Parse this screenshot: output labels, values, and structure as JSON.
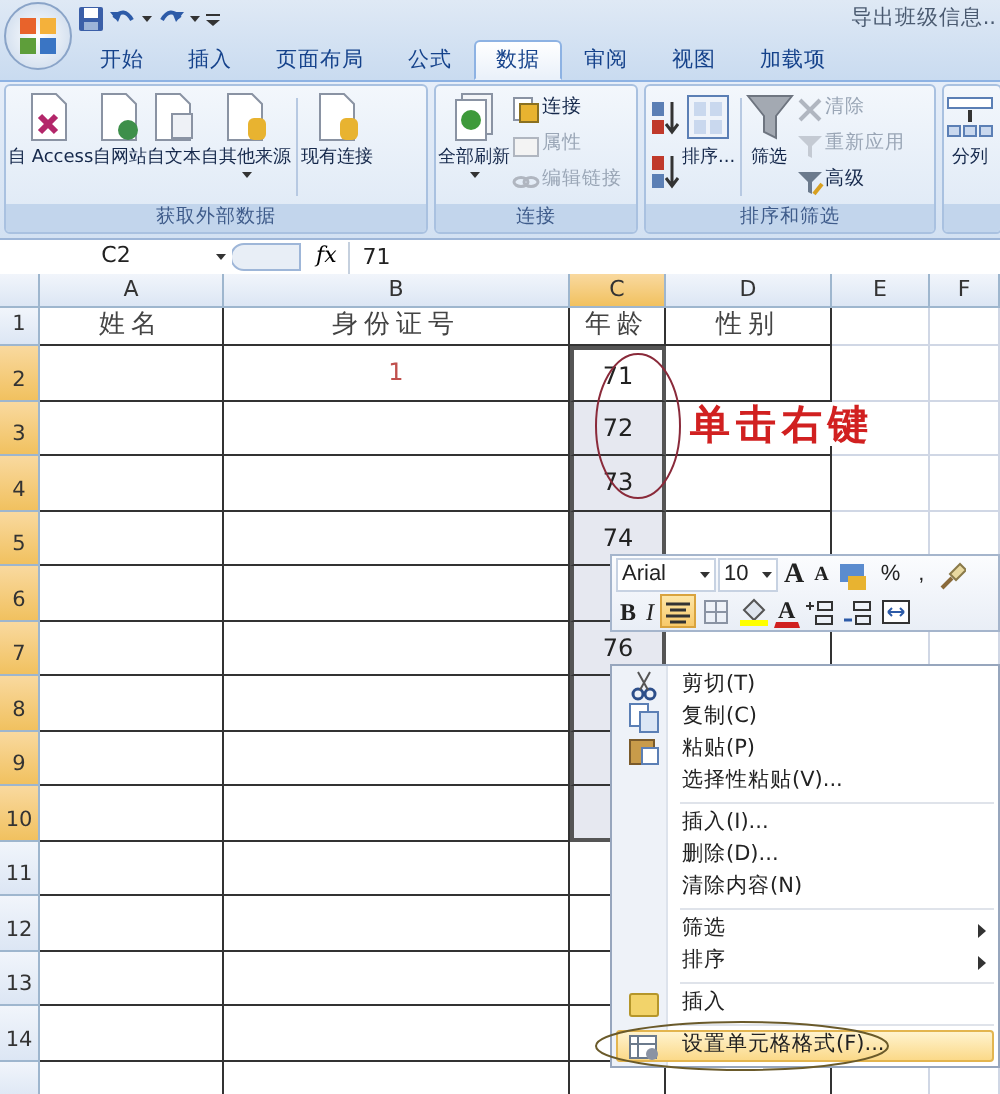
{
  "title_bar": {
    "title": "导出班级信息.."
  },
  "tabs": [
    {
      "label": "开始",
      "selected": false
    },
    {
      "label": "插入",
      "selected": false
    },
    {
      "label": "页面布局",
      "selected": false
    },
    {
      "label": "公式",
      "selected": false
    },
    {
      "label": "数据",
      "selected": true
    },
    {
      "label": "审阅",
      "selected": false
    },
    {
      "label": "视图",
      "selected": false
    },
    {
      "label": "加载项",
      "selected": false
    }
  ],
  "ribbon_groups": [
    {
      "label": "获取外部数据",
      "buttons": [
        {
          "label": "自 Access",
          "kind": "large",
          "dropdown": false
        },
        {
          "label": "自网站",
          "kind": "large",
          "dropdown": false
        },
        {
          "label": "自文本",
          "kind": "large",
          "dropdown": false
        },
        {
          "label": "自其他来源",
          "kind": "large",
          "dropdown": true
        },
        {
          "label": "现有连接",
          "kind": "large",
          "dropdown": false,
          "divider_before": true
        }
      ]
    },
    {
      "label": "连接",
      "buttons": [
        {
          "label": "全部刷新",
          "kind": "large",
          "dropdown": true
        },
        {
          "label": "连接",
          "kind": "small",
          "disabled": false
        },
        {
          "label": "属性",
          "kind": "small",
          "disabled": true
        },
        {
          "label": "编辑链接",
          "kind": "small",
          "disabled": true
        }
      ]
    },
    {
      "label": "排序和筛选",
      "buttons": [
        {
          "kind": "icon"
        },
        {
          "kind": "icon"
        },
        {
          "label": "排序...",
          "kind": "large",
          "dropdown": false
        },
        {
          "label": "筛选",
          "kind": "large",
          "dropdown": false,
          "divider_before": true
        },
        {
          "label": "清除",
          "kind": "small",
          "disabled": true
        },
        {
          "label": "重新应用",
          "kind": "small",
          "disabled": true
        },
        {
          "label": "高级",
          "kind": "small",
          "disabled": false
        }
      ]
    },
    {
      "buttons": [
        {
          "label": "分列",
          "kind": "large",
          "dropdown": false
        }
      ]
    }
  ],
  "formula_bar": {
    "name_box": "C2",
    "insert_function": "fx",
    "value": "71"
  },
  "columns": [
    {
      "label": "A",
      "selected": false
    },
    {
      "label": "B",
      "selected": false
    },
    {
      "label": "C",
      "selected": true
    },
    {
      "label": "D",
      "selected": false
    },
    {
      "label": "E",
      "selected": false
    },
    {
      "label": "F",
      "selected": false
    }
  ],
  "rows": [
    {
      "label": "1",
      "selected": false,
      "cells": {
        "a": {
          "text": "姓名"
        },
        "b": {
          "text": "身份证号"
        },
        "c": {
          "text": "年龄"
        },
        "d": {
          "text": "性别"
        }
      }
    },
    {
      "label": "2",
      "selected": true,
      "cells": {
        "b": {
          "text": "1",
          "color": "#c0504d"
        },
        "c": {
          "text": "71",
          "active": true
        }
      }
    },
    {
      "label": "3",
      "selected": true,
      "cells": {
        "c": {
          "text": "72",
          "active": false
        }
      }
    },
    {
      "label": "4",
      "selected": true,
      "cells": {
        "c": {
          "text": "73",
          "active": false
        }
      }
    },
    {
      "label": "5",
      "selected": true,
      "cells": {
        "c": {
          "text": "74",
          "active": false
        }
      }
    },
    {
      "label": "6",
      "selected": true,
      "cells": {}
    },
    {
      "label": "7",
      "selected": true,
      "cells": {
        "c": {
          "text": "76",
          "active": false
        }
      }
    },
    {
      "label": "8",
      "selected": true,
      "cells": {}
    },
    {
      "label": "9",
      "selected": true,
      "cells": {}
    },
    {
      "label": "10",
      "selected": true,
      "cells": {}
    },
    {
      "label": "11",
      "selected": false,
      "cells": {}
    },
    {
      "label": "12",
      "selected": false,
      "cells": {}
    },
    {
      "label": "13",
      "selected": false,
      "cells": {}
    },
    {
      "label": "14",
      "selected": false,
      "cells": {}
    }
  ],
  "annotation": {
    "text": "单击右键"
  },
  "mini_toolbar": {
    "font": "Arial",
    "size": "10",
    "row_1": [
      {
        "kind": "grow",
        "label": "A"
      },
      {
        "kind": "shrink",
        "label": "A"
      },
      {
        "kind": "styles"
      },
      {
        "kind": "text",
        "label": "%"
      },
      {
        "kind": "text",
        "label": ","
      },
      {
        "kind": "painter"
      }
    ],
    "row_2": [
      {
        "kind": "bold",
        "label": "B",
        "on": false
      },
      {
        "kind": "italic",
        "label": "I",
        "on": false
      },
      {
        "kind": "align",
        "on": true
      },
      {
        "kind": "borders",
        "on": false
      },
      {
        "kind": "fill",
        "on": false
      },
      {
        "kind": "fontcolor",
        "label": "A",
        "on": false
      },
      {
        "kind": "inc_decimal",
        "on": false
      },
      {
        "kind": "dec_decimal",
        "on": false
      },
      {
        "kind": "merge",
        "on": false
      }
    ]
  },
  "context_menu": [
    {
      "kind": "cut",
      "label": "剪切(T)",
      "submenu": false,
      "selected": false
    },
    {
      "kind": "copy",
      "label": "复制(C)",
      "submenu": false,
      "selected": false
    },
    {
      "kind": "paste",
      "label": "粘贴(P)",
      "submenu": false,
      "selected": false
    },
    {
      "kind": "plain",
      "label": "选择性粘贴(V)...",
      "submenu": false,
      "selected": false
    },
    {
      "kind": "separator"
    },
    {
      "kind": "plain",
      "label": "插入(I)...",
      "submenu": false,
      "selected": false
    },
    {
      "kind": "plain",
      "label": "删除(D)...",
      "submenu": false,
      "selected": false
    },
    {
      "kind": "plain",
      "label": "清除内容(N)",
      "submenu": false,
      "selected": false
    },
    {
      "kind": "separator"
    },
    {
      "kind": "plain",
      "label": "筛选",
      "submenu": true,
      "selected": false
    },
    {
      "kind": "plain",
      "label": "排序",
      "submenu": true,
      "selected": false
    },
    {
      "kind": "separator"
    },
    {
      "kind": "note",
      "label": "插入",
      "submenu": false,
      "selected": false
    },
    {
      "kind": "separator"
    },
    {
      "kind": "format",
      "label": "设置单元格格式(F)...",
      "submenu": false,
      "selected": true
    }
  ]
}
